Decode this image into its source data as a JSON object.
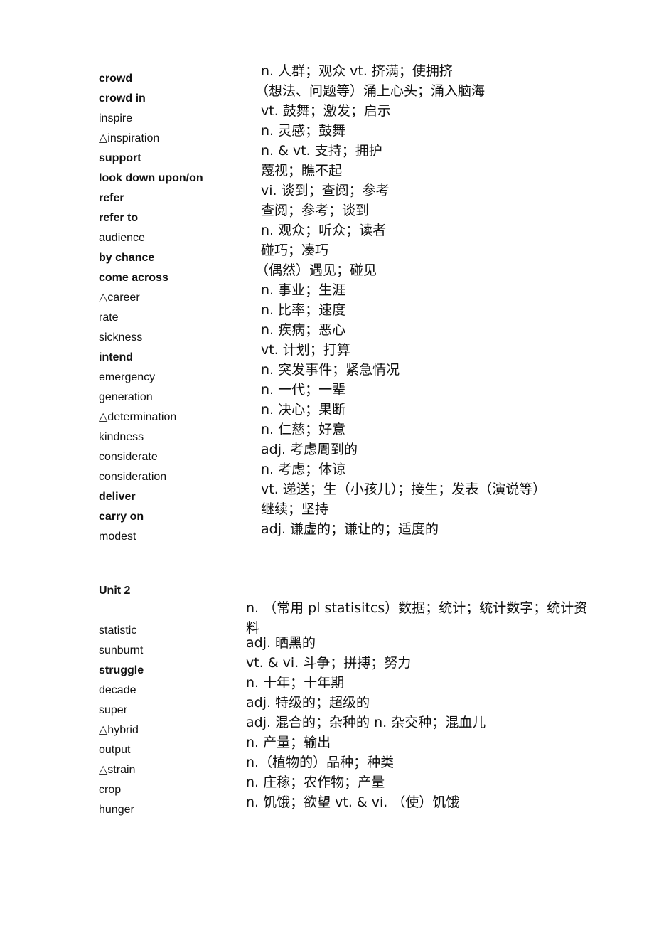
{
  "unit1": {
    "entries": [
      {
        "term": "crowd",
        "definition": "n. 人群；观众 vt. 挤满；使拥挤",
        "bold": true
      },
      {
        "term": "crowd in",
        "definition": "（想法、问题等）涌上心头；涌入脑海",
        "bold": true
      },
      {
        "term": "inspire",
        "definition": "vt. 鼓舞；激发；启示",
        "bold": false
      },
      {
        "term": "△inspiration",
        "definition": "n. 灵感；鼓舞",
        "bold": false
      },
      {
        "term": "support",
        "definition": "n. & vt. 支持；拥护",
        "bold": true
      },
      {
        "term": "look down upon/on",
        "definition": "蔑视；瞧不起",
        "bold": true
      },
      {
        "term": "refer",
        "definition": "vi. 谈到；查阅；参考",
        "bold": true
      },
      {
        "term": "refer to",
        "definition": "查阅；参考；谈到",
        "bold": true
      },
      {
        "term": "audience",
        "definition": "n. 观众；听众；读者",
        "bold": false
      },
      {
        "term": "by chance",
        "definition": "碰巧；凑巧",
        "bold": true
      },
      {
        "term": "come across",
        "definition": "（偶然）遇见；碰见",
        "bold": true
      },
      {
        "term": "△career",
        "definition": "n. 事业；生涯",
        "bold": false
      },
      {
        "term": "rate",
        "definition": "n. 比率；速度",
        "bold": false
      },
      {
        "term": "sickness",
        "definition": "n. 疾病；恶心",
        "bold": false
      },
      {
        "term": "intend",
        "definition": "vt. 计划；打算",
        "bold": true
      },
      {
        "term": "emergency",
        "definition": "n. 突发事件；紧急情况",
        "bold": false
      },
      {
        "term": "generation",
        "definition": "n. 一代；一辈",
        "bold": false
      },
      {
        "term": "△determination",
        "definition": "n. 决心；果断",
        "bold": false
      },
      {
        "term": "kindness",
        "definition": "n. 仁慈；好意",
        "bold": false
      },
      {
        "term": "considerate",
        "definition": "adj. 考虑周到的",
        "bold": false
      },
      {
        "term": "consideration",
        "definition": "n. 考虑；体谅",
        "bold": false
      },
      {
        "term": "deliver",
        "definition": "vt. 递送；生（小孩儿）；接生；发表（演说等）",
        "bold": true
      },
      {
        "term": "carry on",
        "definition": "继续；坚持",
        "bold": true
      },
      {
        "term": "modest",
        "definition": "adj. 谦虚的；谦让的；适度的",
        "bold": false
      }
    ]
  },
  "unit2": {
    "title": "Unit 2",
    "statistic": {
      "term": "statistic",
      "definition_line1": "n. （常用 pl  statisitcs）数据；统计；统计数字；统计资",
      "definition_line2": "料"
    },
    "entries": [
      {
        "term": "sunburnt",
        "definition": "adj. 晒黑的",
        "bold": false
      },
      {
        "term": "struggle",
        "definition": "vt. & vi. 斗争；拼搏；努力",
        "bold": true
      },
      {
        "term": "decade",
        "definition": "n. 十年；十年期",
        "bold": false
      },
      {
        "term": "super",
        "definition": "adj. 特级的；超级的",
        "bold": false
      },
      {
        "term": "△hybrid",
        "definition": "adj. 混合的；杂种的 n. 杂交种；混血儿",
        "bold": false
      },
      {
        "term": "output",
        "definition": "n. 产量；输出",
        "bold": false
      },
      {
        "term": "△strain",
        "definition": "n.（植物的）品种；种类",
        "bold": false
      },
      {
        "term": "crop",
        "definition": "n. 庄稼；农作物；产量",
        "bold": false
      },
      {
        "term": "hunger",
        "definition": "n. 饥饿；欲望 vt. & vi. （使）饥饿",
        "bold": false
      }
    ]
  }
}
